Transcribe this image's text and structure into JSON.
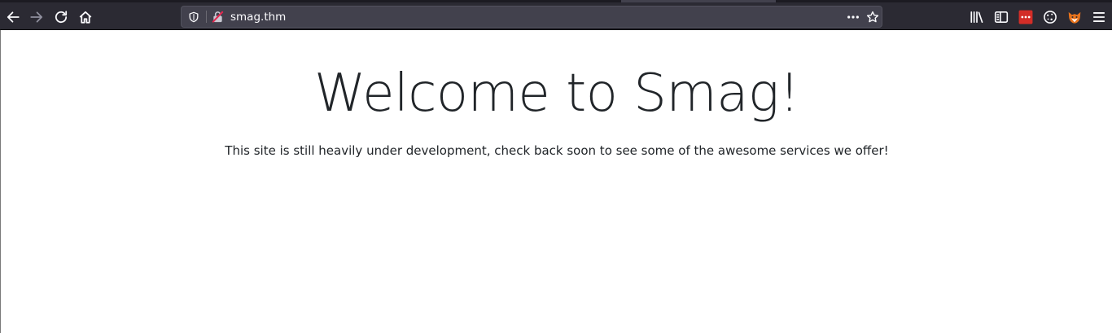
{
  "browser": {
    "url": "smag.thm",
    "icons": [
      "back-icon",
      "forward-icon",
      "reload-icon",
      "home-icon",
      "tracking-shield-icon",
      "insecure-lock-icon",
      "page-actions-icon",
      "bookmark-star-icon",
      "library-icon",
      "sidebar-icon",
      "lastpass-icon",
      "cookie-icon",
      "foxyproxy-icon",
      "menu-icon"
    ]
  },
  "page": {
    "heading": "Welcome to Smag!",
    "lead": "This site is still heavily under development, check back soon to see some of the awesome services we offer!"
  }
}
